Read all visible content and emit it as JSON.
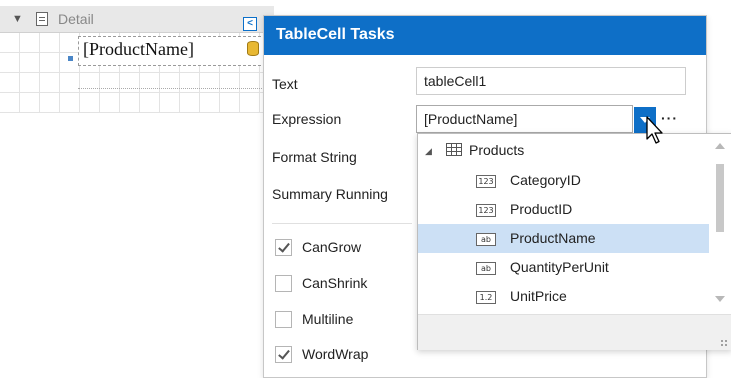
{
  "designer": {
    "band_label": "Detail",
    "table_cell_text": "[ProductName]"
  },
  "panel": {
    "title": "TableCell Tasks",
    "text_label": "Text",
    "text_value": "tableCell1",
    "expression_label": "Expression",
    "expression_value": "[ProductName]",
    "ellipsis": "···",
    "format_string_label": "Format String",
    "summary_running_label": "Summary Running",
    "checkboxes": [
      {
        "label": "CanGrow",
        "checked": true
      },
      {
        "label": "CanShrink",
        "checked": false
      },
      {
        "label": "Multiline",
        "checked": false
      },
      {
        "label": "WordWrap",
        "checked": true
      }
    ]
  },
  "dropdown": {
    "root": {
      "label": "Products",
      "icon": "table-icon"
    },
    "fields": [
      {
        "label": "CategoryID",
        "type_badge": "123",
        "selected": false
      },
      {
        "label": "ProductID",
        "type_badge": "123",
        "selected": false
      },
      {
        "label": "ProductName",
        "type_badge": "ab",
        "selected": true
      },
      {
        "label": "QuantityPerUnit",
        "type_badge": "ab",
        "selected": false
      },
      {
        "label": "UnitPrice",
        "type_badge": "1.2",
        "selected": false
      }
    ]
  },
  "colors": {
    "accent": "#0e6fc7",
    "selected_row": "#cce0f5",
    "band_header": "#e8e8e8"
  }
}
